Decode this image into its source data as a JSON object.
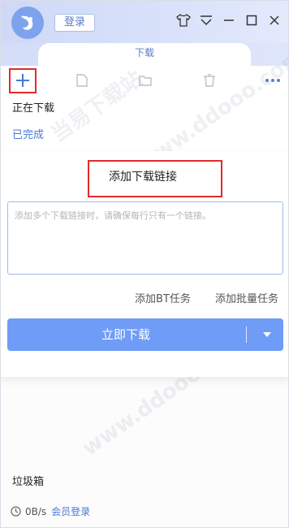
{
  "titlebar": {
    "login_label": "登录"
  },
  "tabs": {
    "download_label": "下载"
  },
  "toolbar": {
    "icons": [
      "plus-icon",
      "file-icon",
      "folder-icon",
      "trash-icon",
      "more-icon"
    ]
  },
  "sidebar": {
    "downloading": "正在下载",
    "completed": "已完成",
    "trash": "垃圾箱"
  },
  "dialog": {
    "title": "添加下载链接",
    "input_placeholder": "添加多个下载链接时，请确保每行只有一个链接。",
    "bt_task": "添加BT任务",
    "batch_task": "添加批量任务",
    "start_download": "立即下载"
  },
  "status": {
    "speed": "0B/s",
    "vip_login": "会员登录"
  },
  "watermark": {
    "text_1": "当易下载站",
    "text_2": "www.ddooo.com"
  },
  "colors": {
    "accent": "#6f9cf6",
    "link": "#4a78d6",
    "highlight": "#e02b2b"
  }
}
